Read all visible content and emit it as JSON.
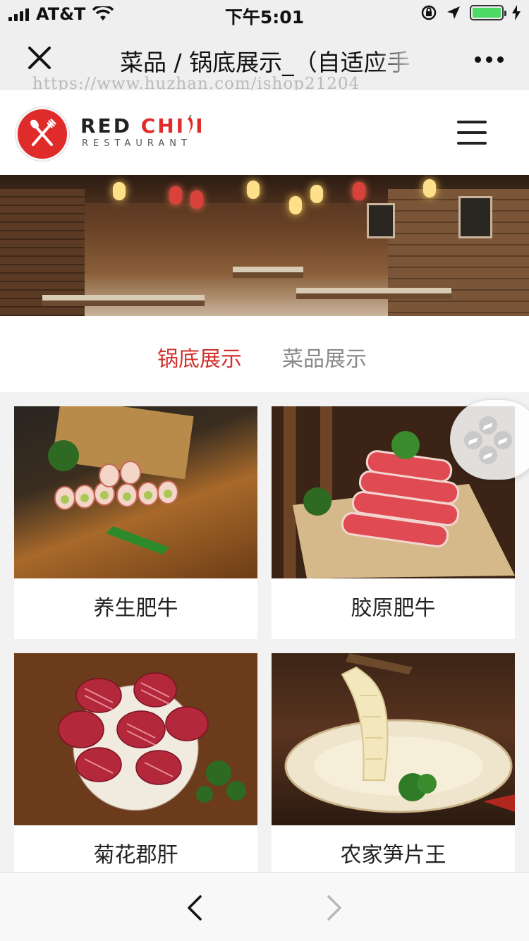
{
  "status_bar": {
    "carrier": "AT&T",
    "time": "下午5:01"
  },
  "nav_bar": {
    "title": "菜品 / 锅底展示_（自适应手",
    "watermark": "https://www.huzhan.com/ishop21204"
  },
  "site_header": {
    "logo_name_part1": "RED ",
    "logo_name_part2": "CHI",
    "logo_name_part3": "I",
    "logo_subtitle": "RESTAURANT"
  },
  "tabs": [
    {
      "label": "锅底展示",
      "active": true
    },
    {
      "label": "菜品展示",
      "active": false
    }
  ],
  "dishes": [
    {
      "name": "养生肥牛"
    },
    {
      "name": "胶原肥牛"
    },
    {
      "name": "菊花郡肝"
    },
    {
      "name": "农家笋片王"
    }
  ],
  "colors": {
    "accent": "#d0312d",
    "tab_inactive": "#8a8a8a",
    "battery": "#4cd964"
  },
  "icons": {
    "close": "close-icon",
    "more": "more-icon",
    "menu": "hamburger-menu-icon",
    "share": "link-chain-icon",
    "back": "chevron-left-icon",
    "forward": "chevron-right-icon"
  }
}
